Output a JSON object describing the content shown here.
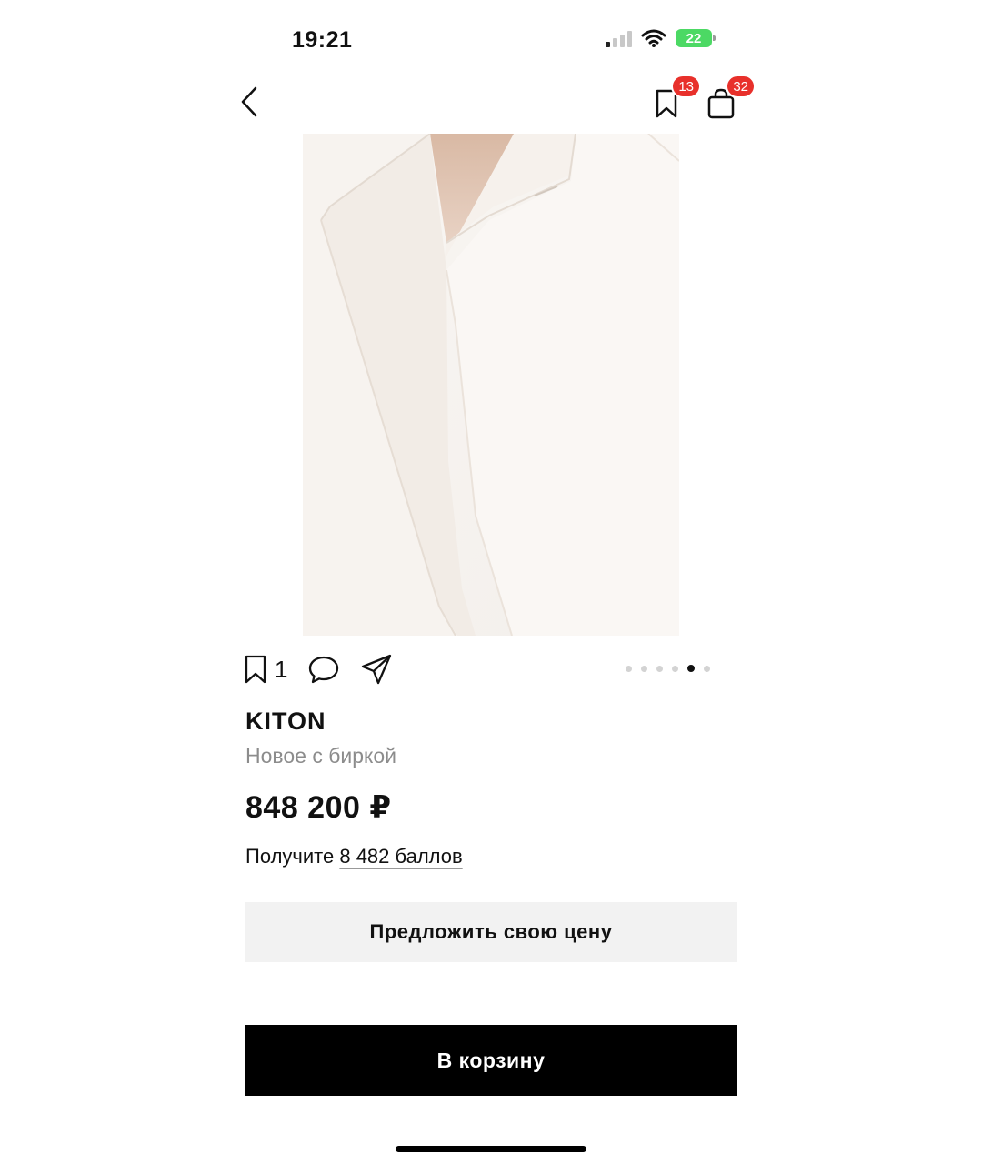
{
  "status_bar": {
    "time": "19:21",
    "battery": "22"
  },
  "nav": {
    "favorites_badge": "13",
    "cart_badge": "32"
  },
  "product": {
    "likes": "1",
    "brand": "KITON",
    "condition": "Новое с биркой",
    "price": "848 200 ₽",
    "bonus_prefix": "Получите",
    "bonus_link": "8 482 баллов"
  },
  "gallery": {
    "total": 6,
    "active_index": 4
  },
  "buttons": {
    "offer_label": "Предложить свою цену",
    "cart_label": "В корзину"
  },
  "colors": {
    "badge": "#e8302b",
    "primary_button": "#000000",
    "secondary_button": "#f2f2f2",
    "muted_text": "#8c8c8c"
  },
  "icons": [
    "back-icon",
    "bookmark-icon",
    "shopping-bag-icon",
    "comment-icon",
    "share-icon",
    "wifi-icon",
    "signal-icon",
    "battery-icon"
  ]
}
